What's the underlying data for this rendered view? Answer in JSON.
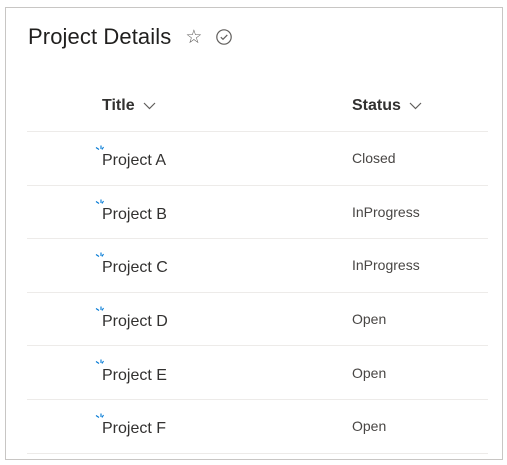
{
  "header": {
    "title": "Project Details",
    "star_icon": "star-outline-icon",
    "check_icon": "checkmark-circle-icon"
  },
  "columns": {
    "title_label": "Title",
    "status_label": "Status"
  },
  "rows": [
    {
      "title": "Project A",
      "status": "Closed"
    },
    {
      "title": "Project B",
      "status": "InProgress"
    },
    {
      "title": "Project C",
      "status": "InProgress"
    },
    {
      "title": "Project D",
      "status": "Open"
    },
    {
      "title": "Project E",
      "status": "Open"
    },
    {
      "title": "Project F",
      "status": "Open"
    }
  ],
  "colors": {
    "new_indicator": "#0078d4",
    "border": "#c8c6c4",
    "row_divider": "#edebe9"
  }
}
